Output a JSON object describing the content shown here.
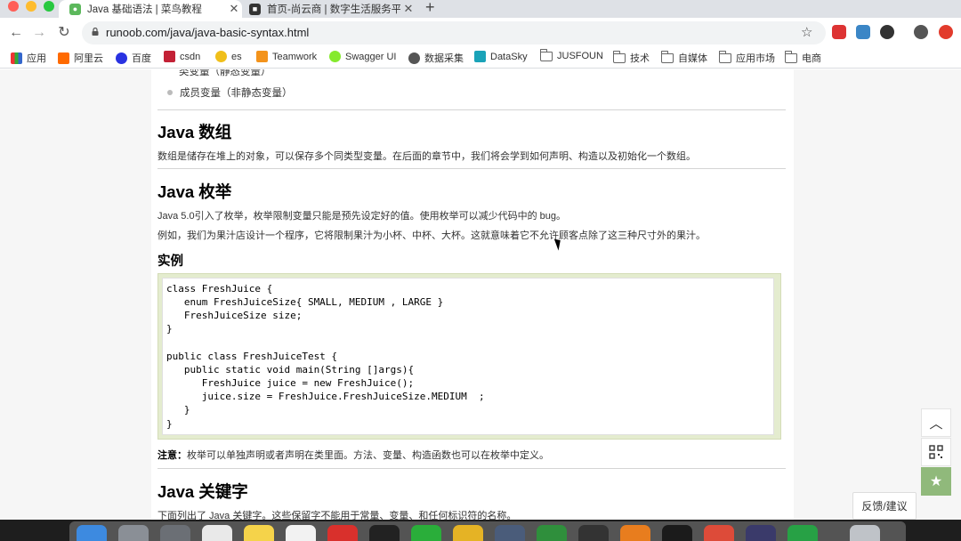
{
  "browser": {
    "tabs": [
      {
        "title": "Java 基础语法 | 菜鸟教程",
        "close": "✕"
      },
      {
        "title": "首页-尚云商 | 数字生活服务平台",
        "close": "✕"
      }
    ],
    "new_tab": "+",
    "url": "runoob.com/java/java-basic-syntax.html",
    "bookmarks": [
      {
        "label": "应用",
        "icon": "apps-grid-icon"
      },
      {
        "label": "阿里云",
        "icon": "aliyun-icon"
      },
      {
        "label": "百度",
        "icon": "baidu-paw-icon"
      },
      {
        "label": "csdn",
        "icon": "csdn-icon"
      },
      {
        "label": "es",
        "icon": "elastic-icon"
      },
      {
        "label": "Teamwork",
        "icon": "teamwork-icon"
      },
      {
        "label": "Swagger UI",
        "icon": "swagger-icon"
      },
      {
        "label": "数据采集",
        "icon": "globe-icon"
      },
      {
        "label": "DataSky",
        "icon": "datasky-icon"
      },
      {
        "label": "JUSFOUN",
        "icon": "folder-icon"
      },
      {
        "label": "技术",
        "icon": "folder-icon"
      },
      {
        "label": "自媒体",
        "icon": "folder-icon"
      },
      {
        "label": "应用市场",
        "icon": "folder-icon"
      },
      {
        "label": "电商",
        "icon": "folder-icon"
      }
    ]
  },
  "article": {
    "bullet_item": "成员变量（非静态变量）",
    "cut_text": "类变量（静态变量）",
    "array_heading": "Java 数组",
    "array_text": "数组是储存在堆上的对象，可以保存多个同类型变量。在后面的章节中，我们将会学到如何声明、构造以及初始化一个数组。",
    "enum_heading": "Java 枚举",
    "enum_text1": "Java 5.0引入了枚举，枚举限制变量只能是预先设定好的值。使用枚举可以减少代码中的 bug。",
    "enum_text2": "例如，我们为果汁店设计一个程序，它将限制果汁为小杯、中杯、大杯。这就意味着它不允许顾客点除了这三种尺寸外的果汁。",
    "example_heading": "实例",
    "code": [
      "class FreshJuice {",
      "   enum FreshJuiceSize{ SMALL, MEDIUM , LARGE }",
      "   FreshJuiceSize size;",
      "}",
      "",
      "public class FreshJuiceTest {",
      "   public static void main(String []args){",
      "      FreshJuice juice = new FreshJuice();",
      "      juice.size = FreshJuice.FreshJuiceSize.MEDIUM  ;",
      "   }",
      "}"
    ],
    "note_label": "注意：",
    "note_text": "枚举可以单独声明或者声明在类里面。方法、变量、构造函数也可以在枚举中定义。",
    "keyword_heading": "Java 关键字",
    "keyword_text": "下面列出了 Java 关键字。这些保留字不能用于常量、变量、和任何标识符的名称。"
  },
  "widgets": {
    "feedback": "反馈/建议",
    "up": "︿",
    "star": "★"
  }
}
